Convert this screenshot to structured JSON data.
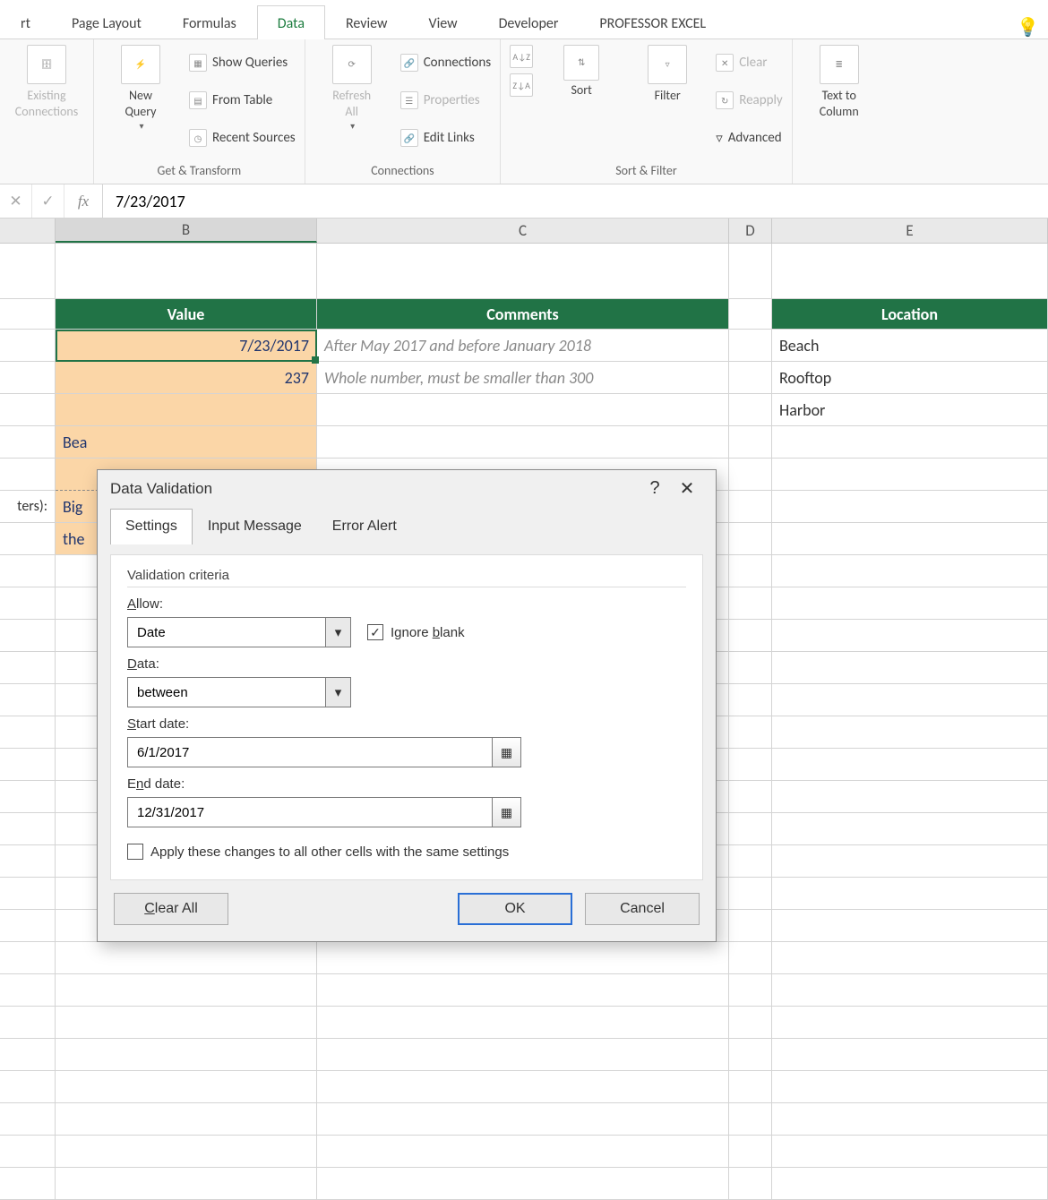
{
  "tabs": {
    "t0": "rt",
    "t1": "Page Layout",
    "t2": "Formulas",
    "t3": "Data",
    "t4": "Review",
    "t5": "View",
    "t6": "Developer",
    "t7": "PROFESSOR EXCEL"
  },
  "ribbon": {
    "existing_connections": "Existing\nConnections",
    "new_query": "New\nQuery",
    "show_queries": "Show Queries",
    "from_table": "From Table",
    "recent_sources": "Recent Sources",
    "group_get_transform": "Get & Transform",
    "refresh_all": "Refresh\nAll",
    "connections": "Connections",
    "properties": "Properties",
    "edit_links": "Edit Links",
    "group_connections": "Connections",
    "sort": "Sort",
    "filter": "Filter",
    "clear": "Clear",
    "reapply": "Reapply",
    "advanced": "Advanced",
    "group_sort_filter": "Sort & Filter",
    "text_to_columns": "Text to\nColumn"
  },
  "formula_bar": {
    "value": "7/23/2017"
  },
  "columns": {
    "B": "B",
    "C": "C",
    "D": "D",
    "E": "E"
  },
  "grid": {
    "hdr_value": "Value",
    "hdr_comments": "Comments",
    "hdr_location": "Location",
    "r1_value": "7/23/2017",
    "r1_comment": "After May 2017 and before January 2018",
    "r2_value": "237",
    "r2_comment": "Whole number, must be smaller than 300",
    "r3_bea": "Bea",
    "r4_a_top": "ters):",
    "r4_big": "Big",
    "r4_the": "the",
    "e1": "Beach",
    "e2": "Rooftop",
    "e3": "Harbor"
  },
  "dialog": {
    "title": "Data Validation",
    "tab_settings": "Settings",
    "tab_input": "Input Message",
    "tab_error": "Error Alert",
    "legend": "Validation criteria",
    "allow_label_pre": "A",
    "allow_label_post": "llow:",
    "allow_value": "Date",
    "ignore_blank_pre": "Ignore ",
    "ignore_blank_u": "b",
    "ignore_blank_post": "lank",
    "ignore_blank_checked": true,
    "data_label_pre": "D",
    "data_label_post": "ata:",
    "data_value": "between",
    "start_label_pre": "S",
    "start_label_post": "tart date:",
    "start_value": "6/1/2017",
    "end_label_pre": "E",
    "end_label_u": "n",
    "end_label_post": "d date:",
    "end_value": "12/31/2017",
    "apply_all": "Apply these changes to all other cells with the same settings",
    "apply_all_checked": false,
    "clear_all_pre": "C",
    "clear_all_post": "lear All",
    "ok": "OK",
    "cancel": "Cancel"
  }
}
